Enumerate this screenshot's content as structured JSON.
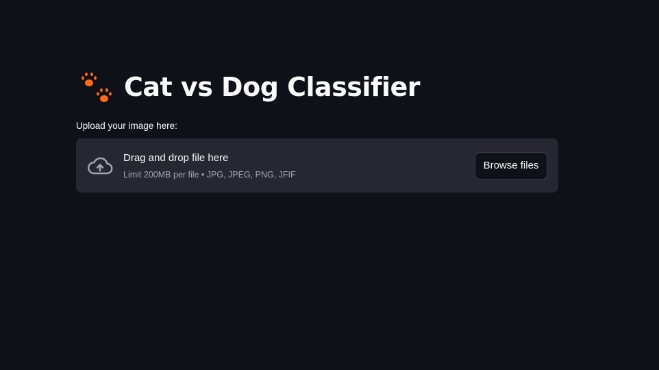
{
  "page": {
    "title": "Cat vs Dog Classifier",
    "title_icon": "paw-prints-icon"
  },
  "uploader": {
    "label": "Upload your image here:",
    "dropzone_text": "Drag and drop file here",
    "limit_text": "Limit 200MB per file • JPG, JPEG, PNG, JFIF",
    "browse_label": "Browse files",
    "icon": "cloud-upload-icon"
  },
  "colors": {
    "background": "#0e1117",
    "dropzone_bg": "#262730",
    "paw_accent": "#ff6a13",
    "text": "#fafafa",
    "muted_text": "#a3a8b4"
  }
}
